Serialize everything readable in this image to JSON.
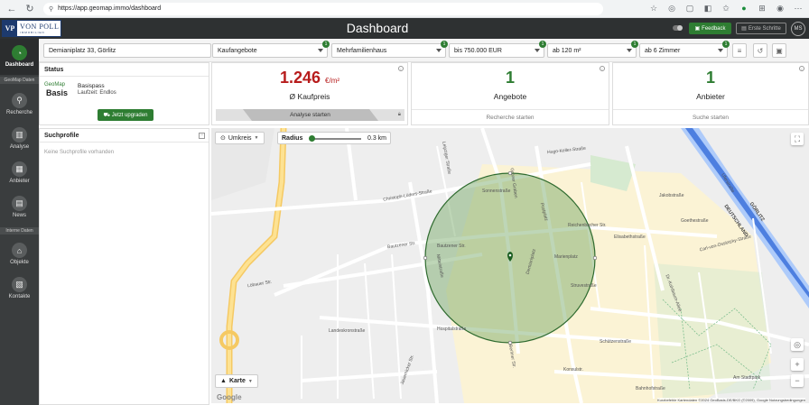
{
  "browser": {
    "url": "https://app.geomap.immo/dashboard"
  },
  "header": {
    "logo_main": "VON POLL",
    "logo_sub": "IMMOBILIEN",
    "logo_mark": "VP",
    "title": "Dashboard",
    "feedback": "Feedback",
    "erste_schritte": "Erste Schritte",
    "user": "MS"
  },
  "sidebar": {
    "dashboard": "Dashboard",
    "section_daten": "GeoMap Daten",
    "recherche": "Recherche",
    "analyse": "Analyse",
    "anbieter": "Anbieter",
    "news": "News",
    "section_interne": "Interne Daten",
    "objekte": "Objekte",
    "kontakte": "Kontakte"
  },
  "filters": {
    "address": "Demianiplatz 33, Görlitz",
    "type": "Kaufangebote",
    "type_badge": "1",
    "object": "Mehrfamilienhaus",
    "object_badge": "1",
    "price": "bis 750.000 EUR",
    "price_badge": "1",
    "area": "ab 120 m²",
    "area_badge": "1",
    "rooms": "ab 6 Zimmer",
    "rooms_badge": "1"
  },
  "status": {
    "title": "Status",
    "brand_small": "GeoMap",
    "plan": "Basis",
    "plan_name": "Basispass",
    "laufzeit": "Laufzeit: Endlos",
    "upgrade": "Jetzt upgraden"
  },
  "cards": {
    "price_value": "1.246",
    "price_unit": "€/m²",
    "price_label": "Ø Kaufpreis",
    "price_action": "Analyse starten",
    "offers_value": "1",
    "offers_label": "Angebote",
    "offers_action": "Recherche starten",
    "providers_value": "1",
    "providers_label": "Anbieter",
    "providers_action": "Suche starten"
  },
  "suchprofile": {
    "title": "Suchprofile",
    "empty": "Keine Suchprofile vorhanden"
  },
  "map": {
    "mode": "Umkreis",
    "radius_label": "Radius",
    "radius_value": "0.3 km",
    "layer": "Karte",
    "google": "Google",
    "attribution": "Kurzbefehle   Kartendaten ©2024 GeoBasis-DE/BKG (©2009), Google   Nutzungsbedingungen",
    "streets": [
      "Christoph-Lüders-Straße",
      "Bautzener Str.",
      "Bautzener Str.",
      "Hugo-Keller-Straße",
      "Elisabethstraße",
      "Schützenstraße",
      "Struvestraße",
      "Berliner Str.",
      "Jakobstraße",
      "Landeskronstraße",
      "Uferstraße",
      "Sonnenstraße",
      "Am Stadtpark",
      "Reichenbacher Str.",
      "Dr.-Kahlbaum-Allee",
      "Goethestraße",
      "Konsulstr.",
      "Bahnhofstraße",
      "Grüner Graben",
      "Postplatz",
      "Marienplatz",
      "Hospitalstraße",
      "Demianiplatz",
      "Löbauer Str.",
      "Jauernicker Str.",
      "Carl-von-Ossietzky-Straße",
      "Mittelstraße",
      "Leipziger Straße"
    ],
    "river_labels": [
      "GÖRLITZ",
      "DEUTSCHLAND"
    ]
  }
}
